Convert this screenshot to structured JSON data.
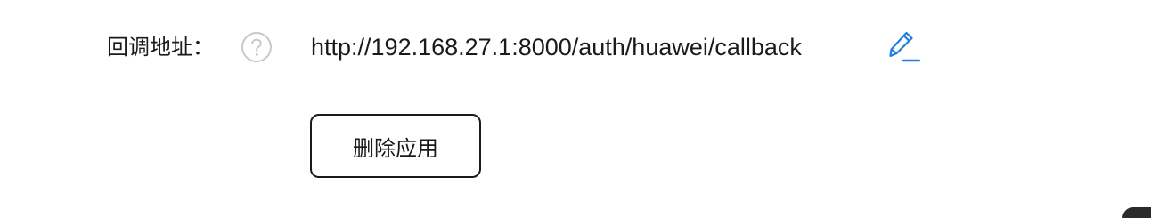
{
  "callback": {
    "label": "回调地址：",
    "url": "http://192.168.27.1:8000/auth/huawei/callback"
  },
  "icons": {
    "help": "question-circle-icon",
    "edit": "pencil-edit-icon"
  },
  "actions": {
    "delete_label": "删除应用"
  },
  "colors": {
    "text": "#1a1a1a",
    "help_icon": "#c8c8c8",
    "accent": "#1e7fe0"
  }
}
